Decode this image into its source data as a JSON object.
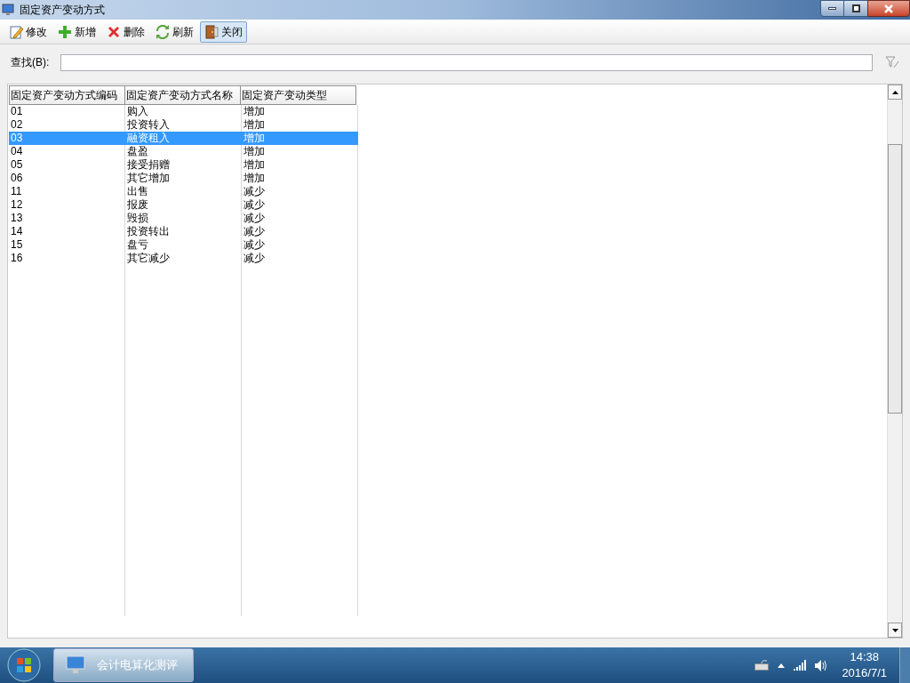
{
  "window": {
    "title": "固定资产变动方式"
  },
  "toolbar": [
    {
      "kind": "edit",
      "label": "修改",
      "pressed": false
    },
    {
      "kind": "add",
      "label": "新增",
      "pressed": false
    },
    {
      "kind": "delete",
      "label": "删除",
      "pressed": false
    },
    {
      "kind": "refresh",
      "label": "刷新",
      "pressed": false
    },
    {
      "kind": "close",
      "label": "关闭",
      "pressed": true
    }
  ],
  "search": {
    "label": "查找(B):"
  },
  "table": {
    "columns": [
      "固定资产变动方式编码",
      "固定资产变动方式名称",
      "固定资产变动类型"
    ],
    "rows": [
      {
        "cells": [
          "01",
          "购入",
          "增加"
        ],
        "selected": false
      },
      {
        "cells": [
          "02",
          "投资转入",
          "增加"
        ],
        "selected": false
      },
      {
        "cells": [
          "03",
          "融资租入",
          "增加"
        ],
        "selected": true
      },
      {
        "cells": [
          "04",
          "盘盈",
          "增加"
        ],
        "selected": false
      },
      {
        "cells": [
          "05",
          "接受捐赠",
          "增加"
        ],
        "selected": false
      },
      {
        "cells": [
          "06",
          "其它增加",
          "增加"
        ],
        "selected": false
      },
      {
        "cells": [
          "11",
          "出售",
          "减少"
        ],
        "selected": false
      },
      {
        "cells": [
          "12",
          "报废",
          "减少"
        ],
        "selected": false
      },
      {
        "cells": [
          "13",
          "毁损",
          "减少"
        ],
        "selected": false
      },
      {
        "cells": [
          "14",
          "投资转出",
          "减少"
        ],
        "selected": false
      },
      {
        "cells": [
          "15",
          "盘亏",
          "减少"
        ],
        "selected": false
      },
      {
        "cells": [
          "16",
          "其它减少",
          "减少"
        ],
        "selected": false
      }
    ]
  },
  "taskbar": {
    "app": "会计电算化测评",
    "time": "14:38",
    "date": "2016/7/1"
  }
}
